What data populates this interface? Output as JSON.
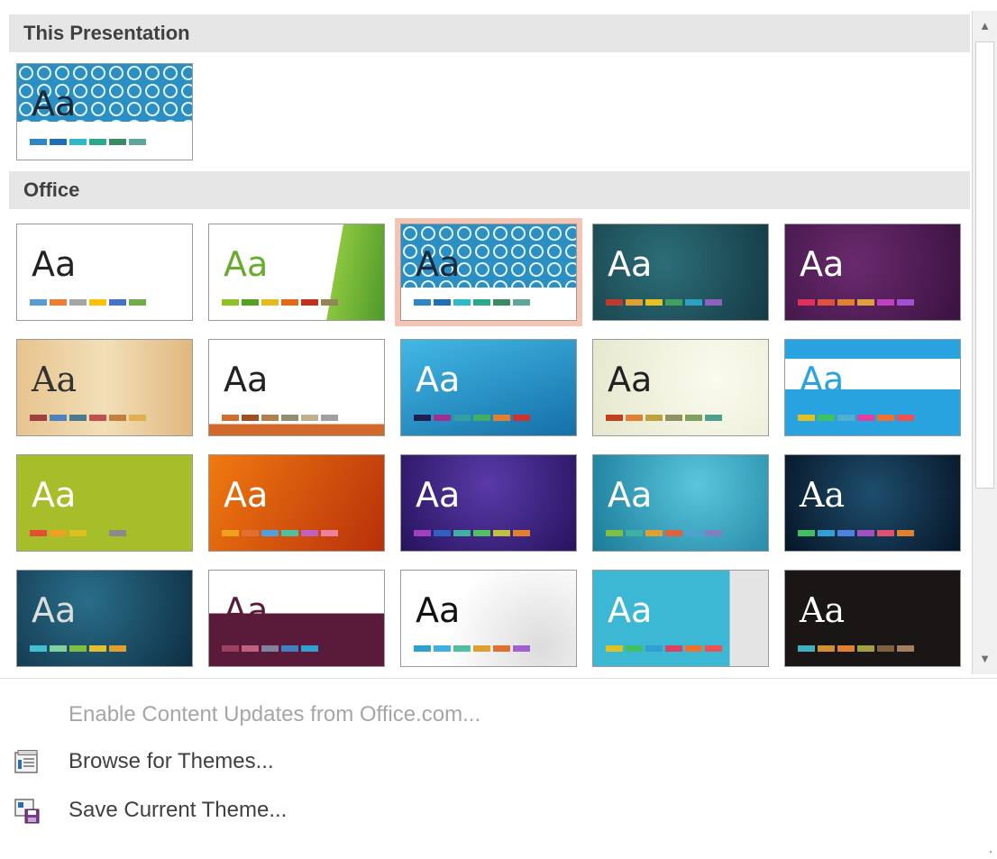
{
  "sections": {
    "this_presentation": "This Presentation",
    "office": "Office"
  },
  "current_theme": {
    "label": "Aa",
    "swatches": [
      "#2e86c7",
      "#1f6fb5",
      "#2dbbc9",
      "#2aa98d",
      "#3b8a63",
      "#5ea59b"
    ]
  },
  "themes": [
    {
      "label": "Aa",
      "style": "office",
      "swatches": [
        "#5b9bd5",
        "#ed7d31",
        "#a5a5a5",
        "#ffc000",
        "#4472c4",
        "#70ad47"
      ]
    },
    {
      "label": "Aa",
      "style": "facet",
      "swatches": [
        "#90c226",
        "#54a021",
        "#e6b91e",
        "#e76618",
        "#c42f1a",
        "#918655"
      ]
    },
    {
      "label": "Aa",
      "style": "pattern",
      "selected": true,
      "swatches": [
        "#2e86c7",
        "#1f6fb5",
        "#2dbbc9",
        "#2aa98d",
        "#3b8a63",
        "#5ea59b"
      ]
    },
    {
      "label": "Aa",
      "style": "dark-teal",
      "swatches": [
        "#c0392b",
        "#e0a030",
        "#e8c020",
        "#3fa060",
        "#30a0c0",
        "#9060c0"
      ]
    },
    {
      "label": "Aa",
      "style": "purple",
      "swatches": [
        "#e03060",
        "#e05040",
        "#e08030",
        "#e0a040",
        "#c040c0",
        "#a050d0"
      ]
    },
    {
      "label": "Aa",
      "style": "wood",
      "swatches": [
        "#a04040",
        "#4f81bd",
        "#4a7a90",
        "#c0504d",
        "#c08040",
        "#e0b050"
      ]
    },
    {
      "label": "Aa",
      "style": "plain-line",
      "swatches": [
        "#d07030",
        "#a05020",
        "#b08050",
        "#909070",
        "#c0b090",
        "#a0a0a0"
      ]
    },
    {
      "label": "Aa",
      "style": "blue-grad",
      "swatches": [
        "#202050",
        "#a03090",
        "#30a0a0",
        "#40b060",
        "#e08030",
        "#d03030"
      ]
    },
    {
      "label": "Aa",
      "style": "cream",
      "swatches": [
        "#c04020",
        "#e08030",
        "#c0a040",
        "#909060",
        "#80a060",
        "#50a090"
      ]
    },
    {
      "label": "Aa",
      "style": "blue-band",
      "swatches": [
        "#e0c020",
        "#40c060",
        "#50b0d0",
        "#e040a0",
        "#f07030",
        "#f05050"
      ]
    },
    {
      "label": "Aa",
      "style": "lime",
      "swatches": [
        "#e05030",
        "#f0a020",
        "#e0c020",
        "#a0c030",
        "#8a8a8a"
      ]
    },
    {
      "label": "Aa",
      "style": "orange",
      "swatches": [
        "#f0a020",
        "#e07030",
        "#50a0e0",
        "#50c0a0",
        "#c060c0",
        "#f080a0"
      ]
    },
    {
      "label": "Aa",
      "style": "deep-purple",
      "swatches": [
        "#a040c0",
        "#3060c0",
        "#40b0a0",
        "#50c060",
        "#c0c040",
        "#e08030"
      ]
    },
    {
      "label": "Aa",
      "style": "teal-grad",
      "swatches": [
        "#80c040",
        "#40b0a0",
        "#e0a030",
        "#e06040",
        "#50a0d0",
        "#8080c0"
      ]
    },
    {
      "label": "Aa",
      "style": "navy",
      "swatches": [
        "#40c060",
        "#30a0d0",
        "#5080e0",
        "#a050c0",
        "#e05070",
        "#e08030"
      ]
    },
    {
      "label": "Aa",
      "style": "dark-blue",
      "swatches": [
        "#40c0d0",
        "#80d0a0",
        "#80c040",
        "#e0c030",
        "#e0a030"
      ]
    },
    {
      "label": "Aa",
      "style": "maroon",
      "swatches": [
        "#a04060",
        "#c06080",
        "#8080a0",
        "#4080c0",
        "#30a0d0"
      ]
    },
    {
      "label": "Aa",
      "style": "bubbles",
      "swatches": [
        "#30a0d0",
        "#40b0e0",
        "#50c0a0",
        "#e0a030",
        "#e07030",
        "#a060d0"
      ]
    },
    {
      "label": "Aa",
      "style": "cyan-block",
      "swatches": [
        "#e0c020",
        "#40c060",
        "#30a0d0",
        "#e04060",
        "#f07030",
        "#f05050"
      ]
    },
    {
      "label": "Aa",
      "style": "black",
      "swatches": [
        "#40b0c0",
        "#d09030",
        "#e08030",
        "#a0a040",
        "#806040",
        "#a08060"
      ]
    }
  ],
  "menu": {
    "enable_updates": "Enable Content Updates from Office.com...",
    "browse_themes": "Browse for Themes...",
    "save_theme": "Save Current Theme..."
  },
  "icons": {
    "scroll_up": "scroll-up-arrow-icon",
    "scroll_down": "scroll-down-arrow-icon",
    "browse": "browse-themes-icon",
    "save": "save-theme-icon"
  }
}
